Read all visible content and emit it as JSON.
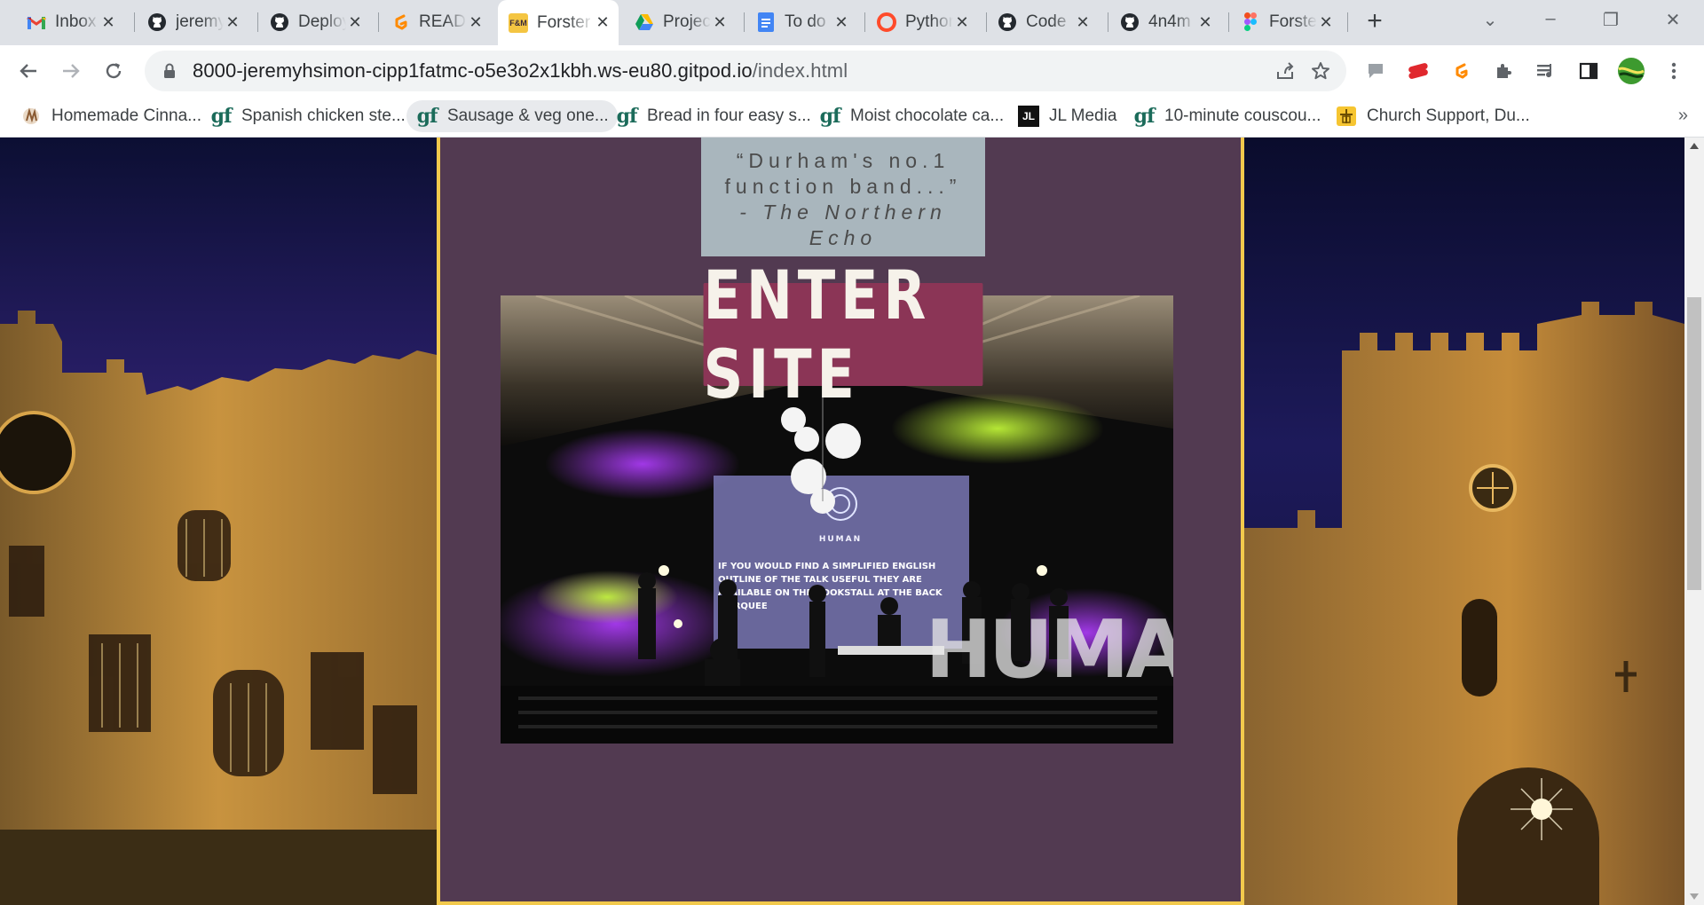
{
  "browser": {
    "tabs": [
      {
        "title": "Inbox",
        "icon": "gmail-icon",
        "active": false
      },
      {
        "title": "jeremyhsimon",
        "icon": "github-icon",
        "active": false
      },
      {
        "title": "Deploy",
        "icon": "github-icon",
        "active": false
      },
      {
        "title": "README",
        "icon": "gitpod-icon",
        "active": false
      },
      {
        "title": "Forster",
        "icon": "fm-icon",
        "active": true
      },
      {
        "title": "Project",
        "icon": "drive-icon",
        "active": false
      },
      {
        "title": "To do",
        "icon": "docs-icon",
        "active": false
      },
      {
        "title": "Python",
        "icon": "opera-icon",
        "active": false
      },
      {
        "title": "Code",
        "icon": "github-icon",
        "active": false
      },
      {
        "title": "4n4m",
        "icon": "github-icon",
        "active": false
      },
      {
        "title": "Forster",
        "icon": "figma-icon",
        "active": false
      }
    ],
    "close_glyph": "✕",
    "new_tab_glyph": "+",
    "url_host": "8000-jeremyhsimon-cipp1fatmc-o5e3o2x1kbh.ws-eu80.gitpod.io",
    "url_path": "/index.html",
    "bookmarks": [
      {
        "label": "Homemade Cinna...",
        "icon": "cinnamon-icon"
      },
      {
        "label": "Spanish chicken ste...",
        "icon": "gf-icon"
      },
      {
        "label": "Sausage & veg one...",
        "icon": "gf-icon"
      },
      {
        "label": "Bread in four easy s...",
        "icon": "gf-icon"
      },
      {
        "label": "Moist chocolate ca...",
        "icon": "gf-icon"
      },
      {
        "label": "JL Media",
        "icon": "jl-icon"
      },
      {
        "label": "10-minute couscou...",
        "icon": "gf-icon"
      },
      {
        "label": "Church Support, Du...",
        "icon": "church-icon"
      }
    ],
    "bookmarks_more": "»",
    "gf_text": "gf",
    "jl_text": "JL",
    "fm_text": "F&M"
  },
  "page": {
    "quote_line1": "“Durham's no.1 function band...”",
    "quote_source": "- The Northern Echo",
    "enter_label": "ENTER SITE",
    "screen_brand": "HUMAN",
    "screen_text": "IF YOU WOULD FIND A SIMPLIFIED ENGLISH OUTLINE OF THE TALK USEFUL THEY ARE AVAILABLE ON THE BOOKSTALL AT THE BACK MARQUEE",
    "big_letters": "HUMAN",
    "colors": {
      "panel": "#523a51",
      "border": "#f2c94c",
      "quote_bg": "#a9b6bd",
      "enter_bg": "#8b3556"
    }
  }
}
